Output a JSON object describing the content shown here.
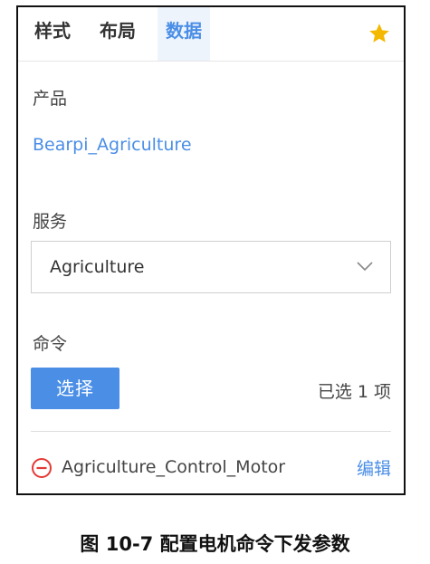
{
  "tabs": [
    {
      "label": "样式"
    },
    {
      "label": "布局"
    },
    {
      "label": "数据",
      "active": true
    }
  ],
  "icons": {
    "favorite": "star-icon",
    "dropdown": "chevron-down-icon",
    "remove": "minus-circle-icon"
  },
  "colors": {
    "accent": "#4a8ee6",
    "star": "#f5b800",
    "remove": "#e53935"
  },
  "product": {
    "label": "产品",
    "value": "Bearpi_Agriculture"
  },
  "service": {
    "label": "服务",
    "selected": "Agriculture"
  },
  "command": {
    "label": "命令",
    "choose_button": "选择",
    "selected_count": "已选 1 项",
    "items": [
      {
        "name": "Agriculture_Control_Motor",
        "action": "编辑"
      }
    ]
  },
  "caption": "图  10-7  配置电机命令下发参数"
}
